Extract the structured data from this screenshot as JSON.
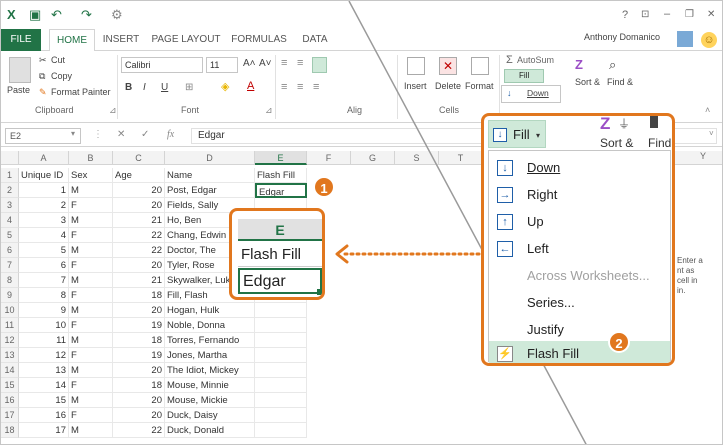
{
  "titlebar": {
    "help": "?",
    "user": "Anthony Domanico",
    "restore_ribbon": "⊡",
    "minimize": "–",
    "restore": "❐",
    "close": "✕"
  },
  "tabs": [
    {
      "label": "FILE"
    },
    {
      "label": "HOME"
    },
    {
      "label": "INSERT"
    },
    {
      "label": "PAGE LAYOUT"
    },
    {
      "label": "FORMULAS"
    },
    {
      "label": "DATA"
    }
  ],
  "ribbon": {
    "paste": "Paste",
    "cut": "Cut",
    "copy": "Copy",
    "format_painter": "Format Painter",
    "clipboard": "Clipboard",
    "font_name": "Calibri",
    "font_size": "11",
    "bold": "B",
    "italic": "I",
    "underline": "U",
    "font_group": "Font",
    "grow_font": "A˄",
    "shrink_font": "A˅",
    "font_color": "A",
    "align_group": "Alig",
    "insert": "Insert",
    "delete": "Delete",
    "format": "Format",
    "cells_group": "Cells",
    "autosum": "AutoSum",
    "fill": "Fill",
    "sort": "Sort &",
    "find": "Find &",
    "dropdown_down": "Down"
  },
  "formula_bar": {
    "name_box": "E2",
    "cancel": "✕",
    "enter": "✓",
    "fx": "fx",
    "formula": "Edgar"
  },
  "columns": [
    "A",
    "B",
    "C",
    "D",
    "E",
    "F",
    "G",
    "S",
    "T"
  ],
  "right_columns": [
    "Y"
  ],
  "header_row": {
    "row": "1",
    "a": "Unique ID",
    "b": "Sex",
    "c": "Age",
    "d": "Name",
    "e": "Flash Fill"
  },
  "rows": [
    {
      "row": "2",
      "id": "1",
      "sex": "M",
      "age": "20",
      "name": "Post, Edgar",
      "e": "Edgar"
    },
    {
      "row": "3",
      "id": "2",
      "sex": "F",
      "age": "20",
      "name": "Fields, Sally",
      "e": ""
    },
    {
      "row": "4",
      "id": "3",
      "sex": "M",
      "age": "21",
      "name": "Ho, Ben",
      "e": ""
    },
    {
      "row": "5",
      "id": "4",
      "sex": "F",
      "age": "22",
      "name": "Chang, Edwin",
      "e": ""
    },
    {
      "row": "6",
      "id": "5",
      "sex": "M",
      "age": "22",
      "name": "Doctor, The",
      "e": ""
    },
    {
      "row": "7",
      "id": "6",
      "sex": "F",
      "age": "20",
      "name": "Tyler, Rose",
      "e": ""
    },
    {
      "row": "8",
      "id": "7",
      "sex": "M",
      "age": "21",
      "name": "Skywalker, Luke",
      "e": ""
    },
    {
      "row": "9",
      "id": "8",
      "sex": "F",
      "age": "18",
      "name": "Fill, Flash",
      "e": ""
    },
    {
      "row": "10",
      "id": "9",
      "sex": "M",
      "age": "20",
      "name": "Hogan, Hulk",
      "e": ""
    },
    {
      "row": "11",
      "id": "10",
      "sex": "F",
      "age": "19",
      "name": "Noble, Donna",
      "e": ""
    },
    {
      "row": "12",
      "id": "11",
      "sex": "M",
      "age": "18",
      "name": "Torres, Fernando",
      "e": ""
    },
    {
      "row": "13",
      "id": "12",
      "sex": "F",
      "age": "19",
      "name": "Jones, Martha",
      "e": ""
    },
    {
      "row": "14",
      "id": "13",
      "sex": "M",
      "age": "20",
      "name": "The Idiot, Mickey",
      "e": ""
    },
    {
      "row": "15",
      "id": "14",
      "sex": "F",
      "age": "18",
      "name": "Mouse, Minnie",
      "e": ""
    },
    {
      "row": "16",
      "id": "15",
      "sex": "M",
      "age": "20",
      "name": "Mouse, Mickie",
      "e": ""
    },
    {
      "row": "17",
      "id": "16",
      "sex": "F",
      "age": "20",
      "name": "Duck, Daisy",
      "e": ""
    },
    {
      "row": "18",
      "id": "17",
      "sex": "M",
      "age": "22",
      "name": "Duck, Donald",
      "e": ""
    }
  ],
  "zoom_callout": {
    "column": "E",
    "header": "Flash Fill",
    "value": "Edgar",
    "badge": "1"
  },
  "fill_menu": {
    "button": "Fill",
    "sort": "Sort &",
    "find": "Find",
    "items": [
      {
        "label": "Down",
        "icon": "↓"
      },
      {
        "label": "Right",
        "icon": "→"
      },
      {
        "label": "Up",
        "icon": "↑"
      },
      {
        "label": "Left",
        "icon": "←"
      },
      {
        "label": "Across Worksheets...",
        "icon": ""
      },
      {
        "label": "Series...",
        "icon": ""
      },
      {
        "label": "Justify",
        "icon": ""
      },
      {
        "label": "Flash Fill",
        "icon": "⚡"
      }
    ],
    "badge": "2"
  },
  "tooltip_fragments": [
    "Enter a",
    "nt as",
    "cell in",
    "in."
  ],
  "colors": {
    "excel_green": "#217346",
    "callout_orange": "#e1771e",
    "menu_highlight": "#cfe9d9",
    "icon_blue": "#1f5fa8"
  }
}
